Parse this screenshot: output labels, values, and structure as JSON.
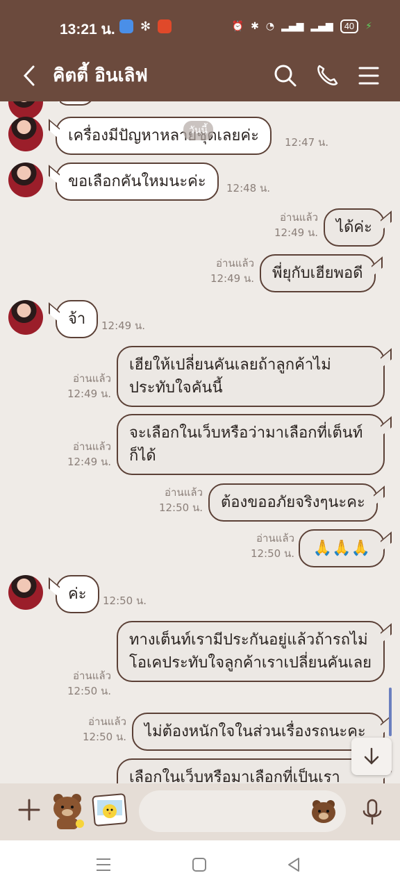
{
  "status_bar": {
    "time": "13:21 น.",
    "battery": "40"
  },
  "header": {
    "title": "คิตตี้ อินเลิฟ"
  },
  "chat": {
    "today_label": "วันนี้",
    "read_label": "อ่านแล้ว",
    "messages": [
      {
        "dir": "in",
        "text": "เครื่องมีปัญหาหลายชุดเลยค่ะ",
        "time": "12:47 น."
      },
      {
        "dir": "in",
        "text": "ขอเลือกคันใหมนะค่ะ",
        "time": "12:48 น."
      },
      {
        "dir": "out",
        "text": "ได้ค่ะ",
        "time": "12:49 น."
      },
      {
        "dir": "out",
        "text": "พี่ยุกับเฮียพอดี",
        "time": "12:49 น."
      },
      {
        "dir": "in",
        "text": "จ้า",
        "time": "12:49 น."
      },
      {
        "dir": "out",
        "text": "เฮียให้เปลี่ยนคันเลยถ้าลูกค้าไม่ประทับใจคันนี้",
        "time": "12:49 น."
      },
      {
        "dir": "out",
        "text": "จะเลือกในเว็บหรือว่ามาเลือกที่เต็นท์ก็ได้",
        "time": "12:49 น."
      },
      {
        "dir": "out",
        "text": "ต้องขออภัยจริงๆนะคะ",
        "time": "12:50 น."
      },
      {
        "dir": "out",
        "text": "🙏🙏🙏",
        "time": "12:50 น."
      },
      {
        "dir": "in",
        "text": "ค่ะ",
        "time": "12:50 น."
      },
      {
        "dir": "out",
        "text": "ทางเต็นท์เรามีประกันอยู่แล้วถ้ารถไม่โอเคประทับใจลูกค้าเราเปลี่ยนคันเลย",
        "time": "12:50 น."
      },
      {
        "dir": "out",
        "text": "ไม่ต้องหนักใจในส่วนเรื่องรถนะคะ",
        "time": "12:50 น."
      },
      {
        "dir": "out",
        "text": "เลือกในเว็บหรือมาเลือกที่เป็นเรา",
        "time": ""
      }
    ]
  },
  "colors": {
    "brand_brown": "#6b4a3d",
    "chat_bg": "#efebe7"
  }
}
